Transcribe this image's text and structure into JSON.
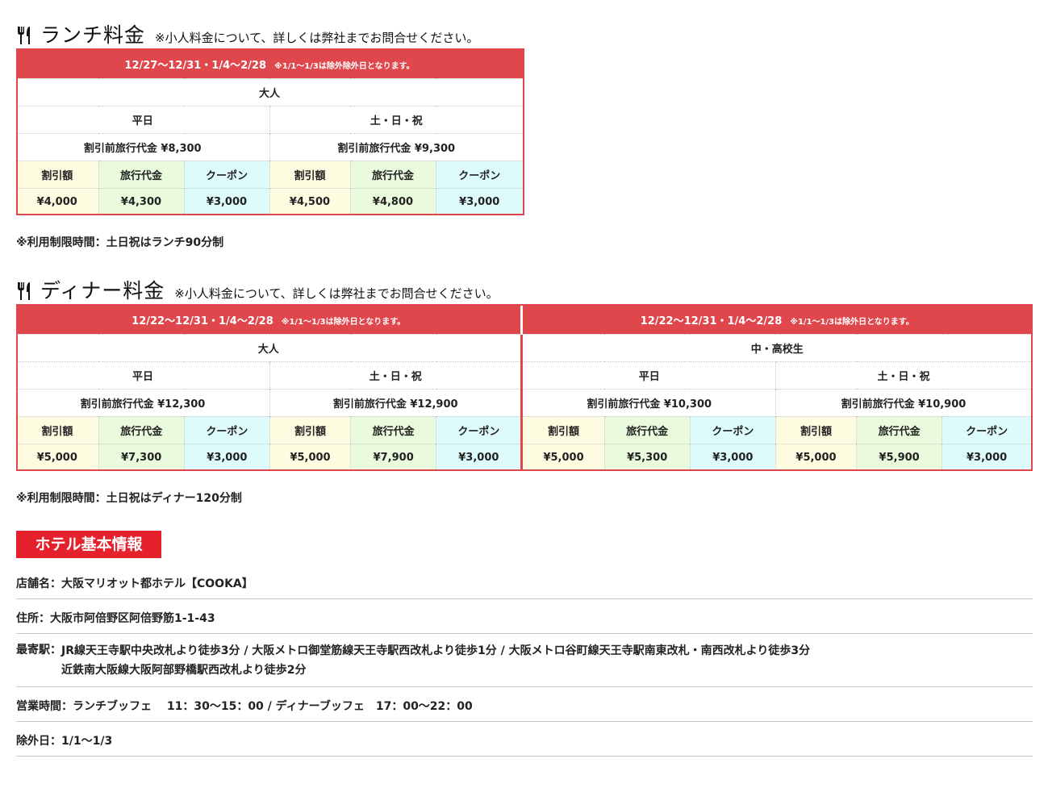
{
  "lunch": {
    "title": "ランチ料金",
    "note": "※小人料金について、詳しくは弊社までお問合せください。",
    "period": "12/27〜12/31・1/4〜2/28",
    "period_note": "※1/1〜1/3は除外除外日となります。",
    "group_label": "大人",
    "weekday_label": "平日",
    "weekend_label": "土・日・祝",
    "weekday_base": "割引前旅行代金 ¥8,300",
    "weekend_base": "割引前旅行代金 ¥9,300",
    "col_labels": [
      "割引額",
      "旅行代金",
      "クーポン",
      "割引額",
      "旅行代金",
      "クーポン"
    ],
    "values": [
      "¥4,000",
      "¥4,300",
      "¥3,000",
      "¥4,500",
      "¥4,800",
      "¥3,000"
    ],
    "footnote": "※利用制限時間：土日祝はランチ90分制"
  },
  "dinner": {
    "title": "ディナー料金",
    "note": "※小人料金について、詳しくは弊社までお問合せください。",
    "groups": [
      {
        "period": "12/22〜12/31・1/4〜2/28",
        "period_note": "※1/1〜1/3は除外日となります。",
        "group_label": "大人",
        "weekday_label": "平日",
        "weekend_label": "土・日・祝",
        "weekday_base": "割引前旅行代金 ¥12,300",
        "weekend_base": "割引前旅行代金 ¥12,900",
        "col_labels": [
          "割引額",
          "旅行代金",
          "クーポン",
          "割引額",
          "旅行代金",
          "クーポン"
        ],
        "values": [
          "¥5,000",
          "¥7,300",
          "¥3,000",
          "¥5,000",
          "¥7,900",
          "¥3,000"
        ]
      },
      {
        "period": "12/22〜12/31・1/4〜2/28",
        "period_note": "※1/1〜1/3は除外日となります。",
        "group_label": "中・高校生",
        "weekday_label": "平日",
        "weekend_label": "土・日・祝",
        "weekday_base": "割引前旅行代金 ¥10,300",
        "weekend_base": "割引前旅行代金 ¥10,900",
        "col_labels": [
          "割引額",
          "旅行代金",
          "クーポン",
          "割引額",
          "旅行代金",
          "クーポン"
        ],
        "values": [
          "¥5,000",
          "¥5,300",
          "¥3,000",
          "¥5,000",
          "¥5,900",
          "¥3,000"
        ]
      }
    ],
    "footnote": "※利用制限時間：土日祝はディナー120分制"
  },
  "hotel": {
    "badge": "ホテル基本情報",
    "name_label": "店舗名：",
    "name_value": "大阪マリオット都ホテル【COOKA】",
    "address_label": "住所：",
    "address_value": "大阪市阿倍野区阿倍野筋1-1-43",
    "station_label": "最寄駅：",
    "station_line1": "JR線天王寺駅中央改札より徒歩3分 / 大阪メトロ御堂筋線天王寺駅西改札より徒歩1分 / 大阪メトロ谷町線天王寺駅南東改札・南西改札より徒歩3分",
    "station_line2": "近鉄南大阪線大阪阿部野橋駅西改札より徒歩2分",
    "hours_label": "営業時間：",
    "hours_value": "ランチブッフェ　 11：30〜15：00 / ディナーブッフェ　17：00〜22：00",
    "closed_label": "除外日：",
    "closed_value": "1/1〜1/3"
  },
  "icon": "fork-knife-icon",
  "colors": {
    "accent": "#e0474c",
    "badge": "#e5212c",
    "discount_bg": "#fdfbe0",
    "price_bg": "#e9fbdc",
    "coupon_bg": "#defbfb"
  }
}
